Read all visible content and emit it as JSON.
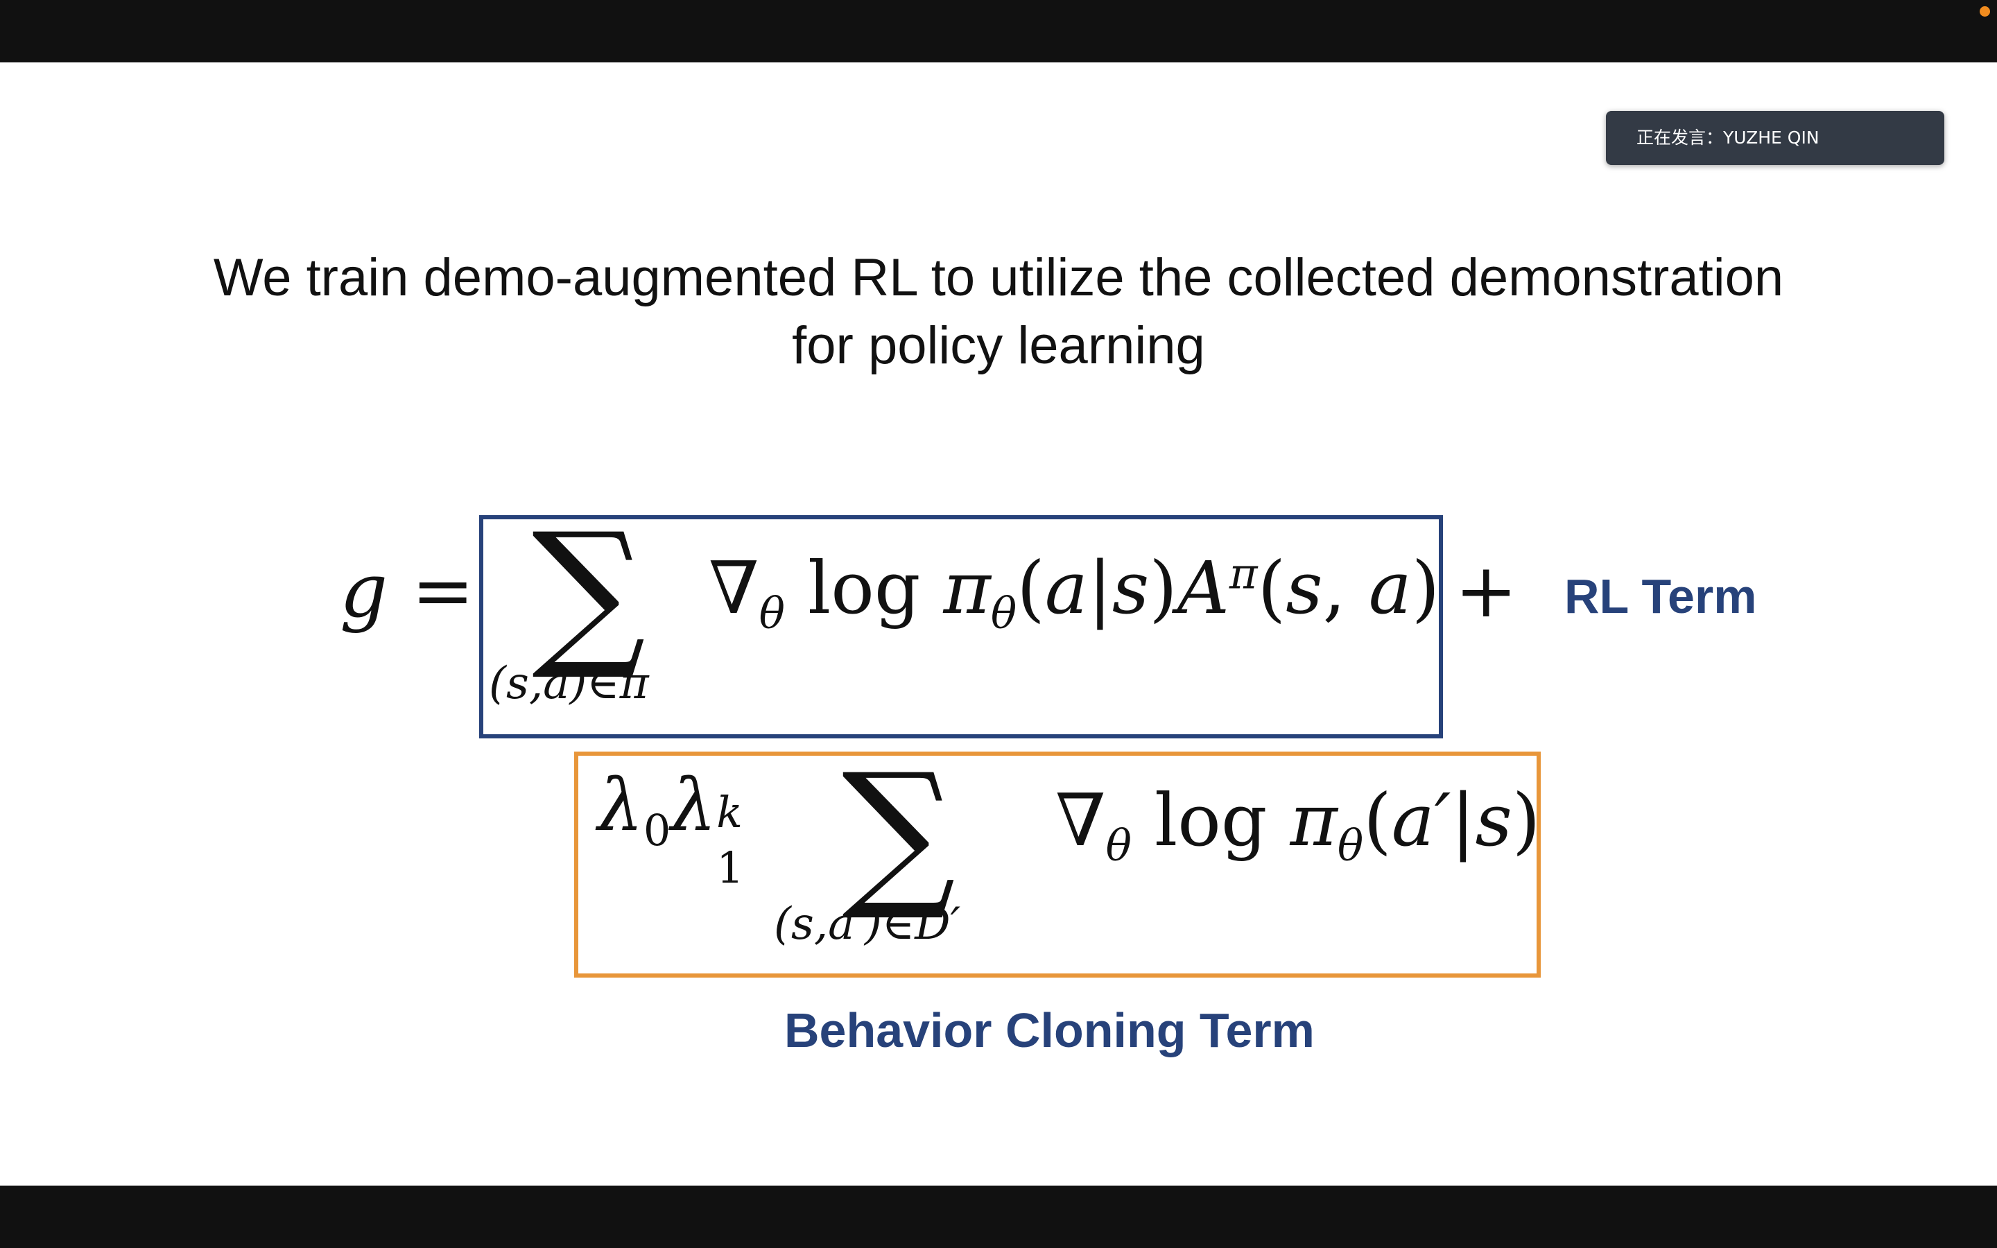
{
  "speaker_badge": {
    "text": "正在发言：YUZHE QIN"
  },
  "slide": {
    "title_line1": "We train demo-augmented RL to utilize the collected demonstration",
    "title_line2": "for policy learning",
    "rl_term_label": "RL Term",
    "bc_term_label": "Behavior Cloning Term"
  },
  "equation": {
    "lhs": "g =",
    "rl_sum_sub": "(s,a)∈π",
    "rl_body": "∇θ log πθ(a|s)Aπ(s, a)",
    "plus": "+",
    "bc_coeff": "λ0λ1k",
    "bc_sum_sub": "(s,a′)∈D′",
    "bc_body": "∇θ log πθ(a′|s)"
  },
  "colors": {
    "rl_box": "#27427a",
    "bc_box": "#e8963a",
    "label": "#27427a",
    "badge_bg": "#333a45",
    "recording_dot": "#f28c1f"
  }
}
